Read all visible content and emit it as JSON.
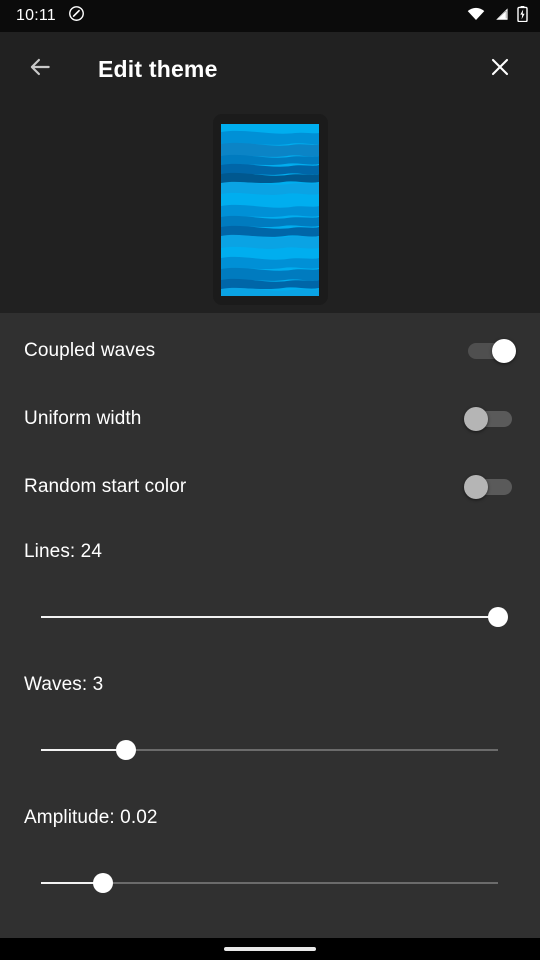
{
  "status_bar": {
    "time": "10:11",
    "left_icons": [
      "do-not-disturb-icon"
    ],
    "right_icons": [
      "wifi-icon",
      "cellular-signal-icon",
      "battery-charging-icon"
    ]
  },
  "app_bar": {
    "back_icon": "arrow-back-icon",
    "title": "Edit theme",
    "close_icon": "close-icon"
  },
  "preview": {
    "name": "theme-preview",
    "wave_colors": [
      "#00AEEF",
      "#0090D6",
      "#007BBF",
      "#0066A8",
      "#00588F",
      "#0aa3e4",
      "#0b84c6"
    ]
  },
  "settings": {
    "switches": [
      {
        "label": "Coupled waves",
        "value": "on"
      },
      {
        "label": "Uniform width",
        "value": "off"
      },
      {
        "label": "Random start color",
        "value": "off"
      }
    ],
    "sliders": [
      {
        "label": "Lines: 24",
        "name": "lines",
        "fraction": 1.0
      },
      {
        "label": "Waves: 3",
        "name": "waves",
        "fraction": 0.186
      },
      {
        "label": "Amplitude: 0.02",
        "name": "amplitude",
        "fraction": 0.136
      }
    ]
  },
  "nav_bar": {
    "handle": "gesture-pill"
  },
  "colors": {
    "status_bar_bg": "#0b0b0b",
    "app_bar_bg": "#212121",
    "settings_bg": "#303030",
    "accent": "#ffffff",
    "wave_bright": "#00AEEF",
    "wave_dark": "#00588F"
  }
}
